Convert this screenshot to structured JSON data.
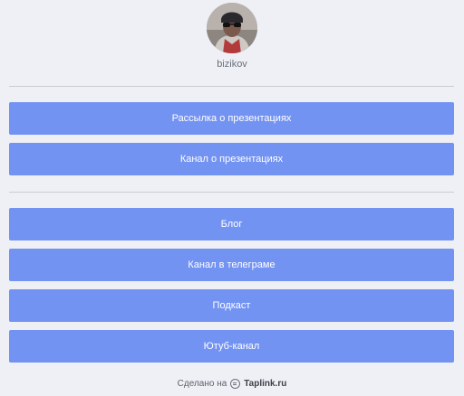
{
  "profile": {
    "username": "bizikov"
  },
  "links_group_1": [
    {
      "label": "Рассылка о презентациях"
    },
    {
      "label": "Канал о презентациях"
    }
  ],
  "links_group_2": [
    {
      "label": "Блог"
    },
    {
      "label": "Канал в телеграме"
    },
    {
      "label": "Подкаст"
    },
    {
      "label": "Ютуб-канал"
    }
  ],
  "footer": {
    "made_on": "Сделано на",
    "brand": "Taplink.ru"
  },
  "colors": {
    "button_bg": "#7393f3",
    "page_bg": "#eef0f6"
  }
}
